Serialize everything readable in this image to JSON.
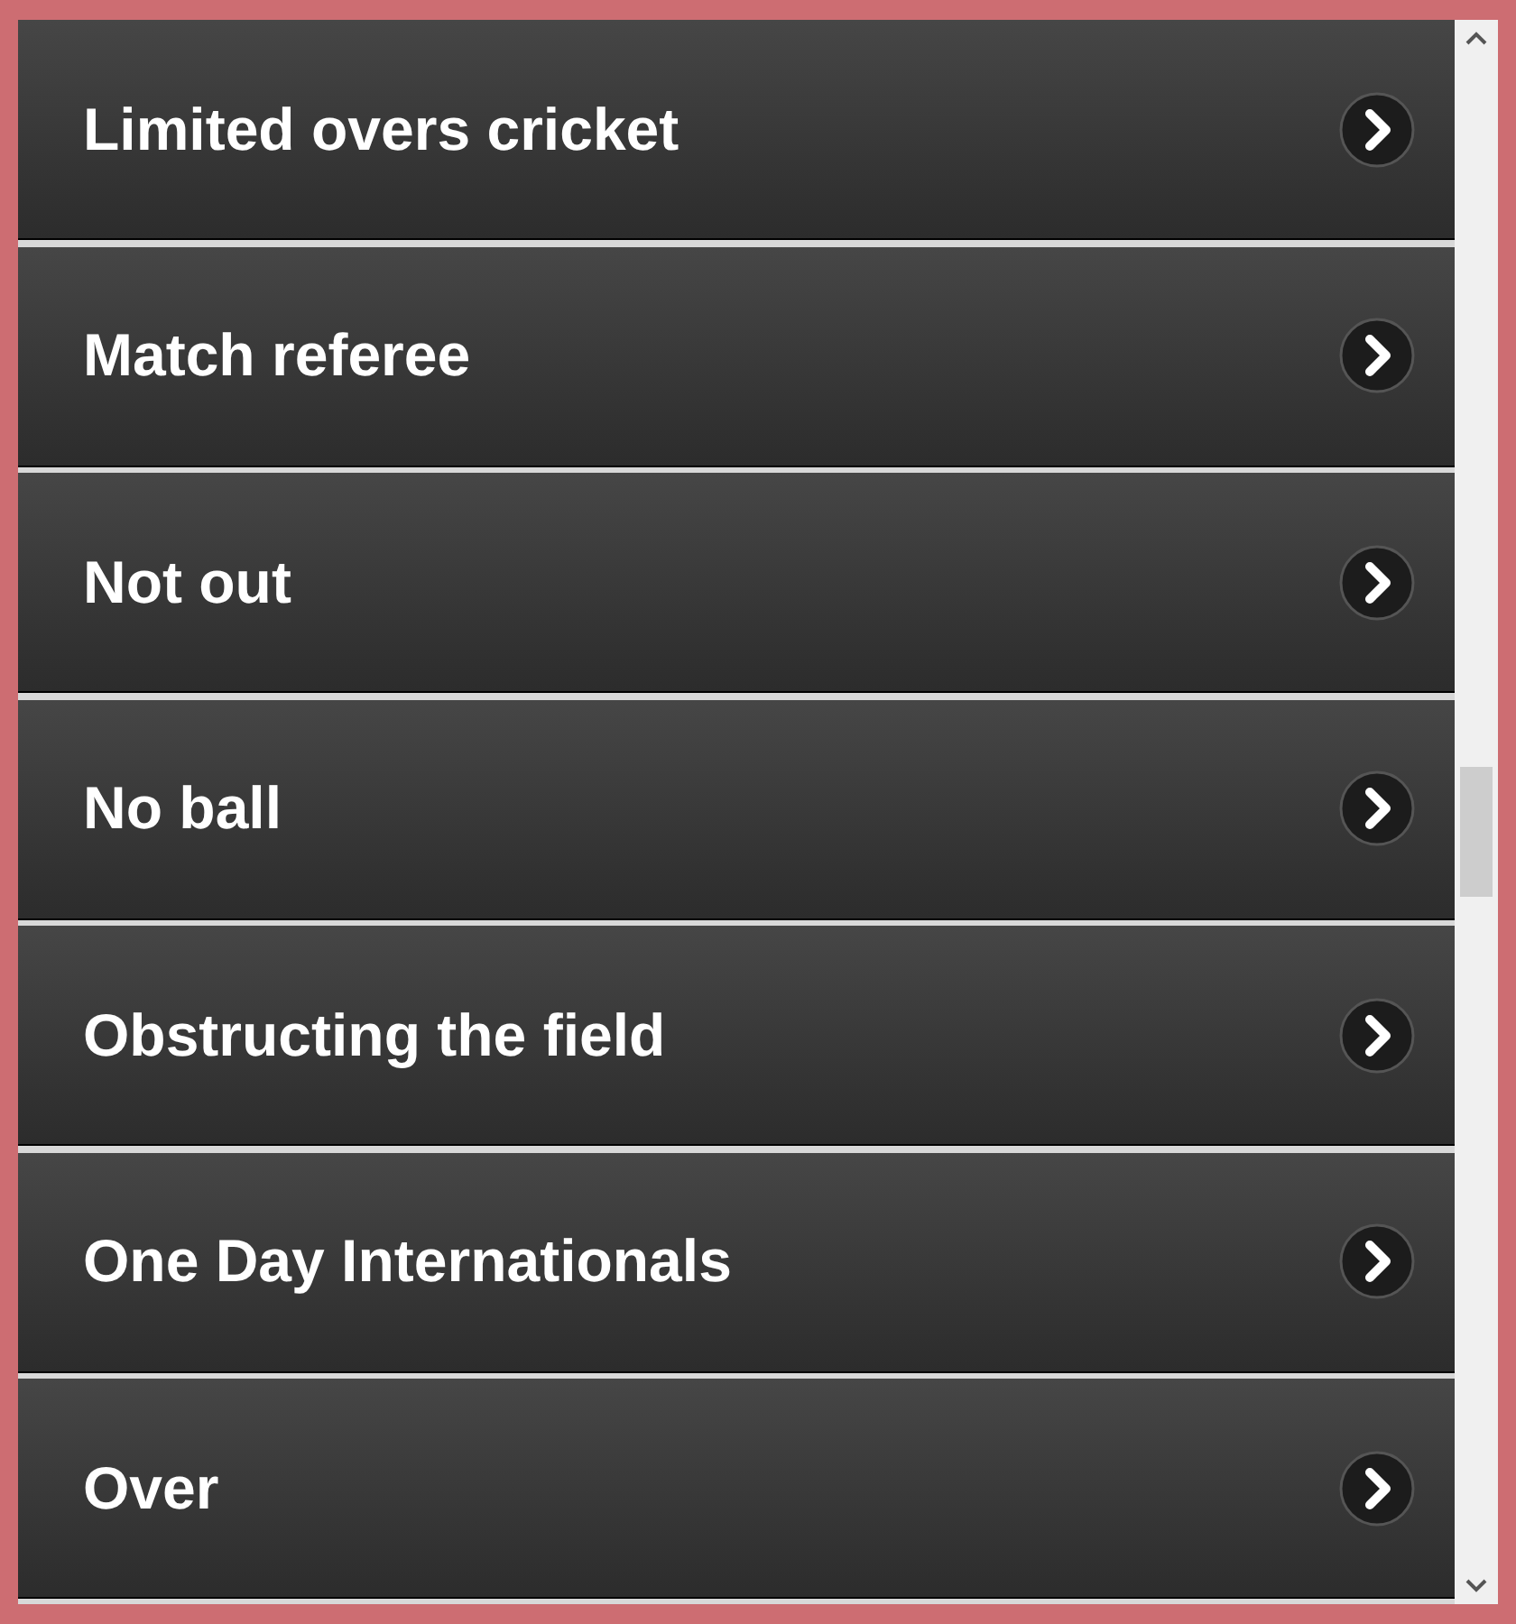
{
  "items": [
    {
      "label": "Limited overs cricket"
    },
    {
      "label": "Match referee"
    },
    {
      "label": "Not out"
    },
    {
      "label": "No ball"
    },
    {
      "label": "Obstructing the field"
    },
    {
      "label": "One Day Internationals"
    },
    {
      "label": "Over"
    }
  ]
}
